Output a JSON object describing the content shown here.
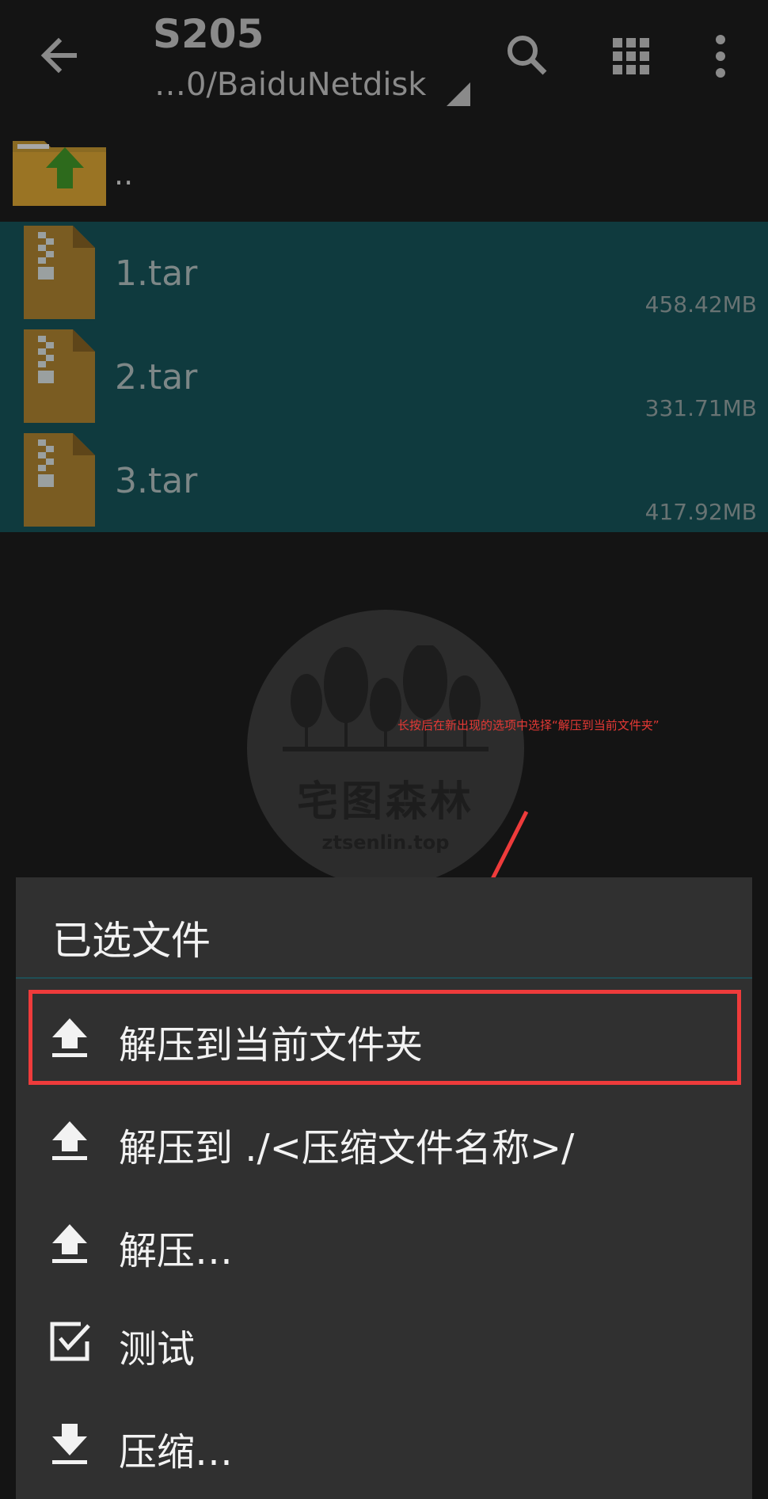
{
  "toolbar": {
    "title": "S205",
    "path": "…0/BaiduNetdisk"
  },
  "files": {
    "parent_label": "..",
    "items": [
      {
        "name": "1.tar",
        "size": "458.42MB"
      },
      {
        "name": "2.tar",
        "size": "331.71MB"
      },
      {
        "name": "3.tar",
        "size": "417.92MB"
      }
    ]
  },
  "watermark": {
    "text_cn": "宅图森林",
    "url": "ztsenlin.top"
  },
  "annotation": {
    "text": "长按后在新出现的选项中选择“解压到当前文件夹”"
  },
  "sheet": {
    "title": "已选文件",
    "items": [
      {
        "label": "解压到当前文件夹",
        "icon": "upload-icon"
      },
      {
        "label": "解压到 ./<压缩文件名称>/",
        "icon": "upload-icon"
      },
      {
        "label": "解压…",
        "icon": "upload-icon"
      },
      {
        "label": "测试",
        "icon": "checkbox-icon"
      },
      {
        "label": "压缩…",
        "icon": "download-icon"
      }
    ]
  },
  "colors": {
    "selection": "#0f3a3e",
    "sheet_bg": "#303030",
    "highlight": "#ee3b3b"
  }
}
